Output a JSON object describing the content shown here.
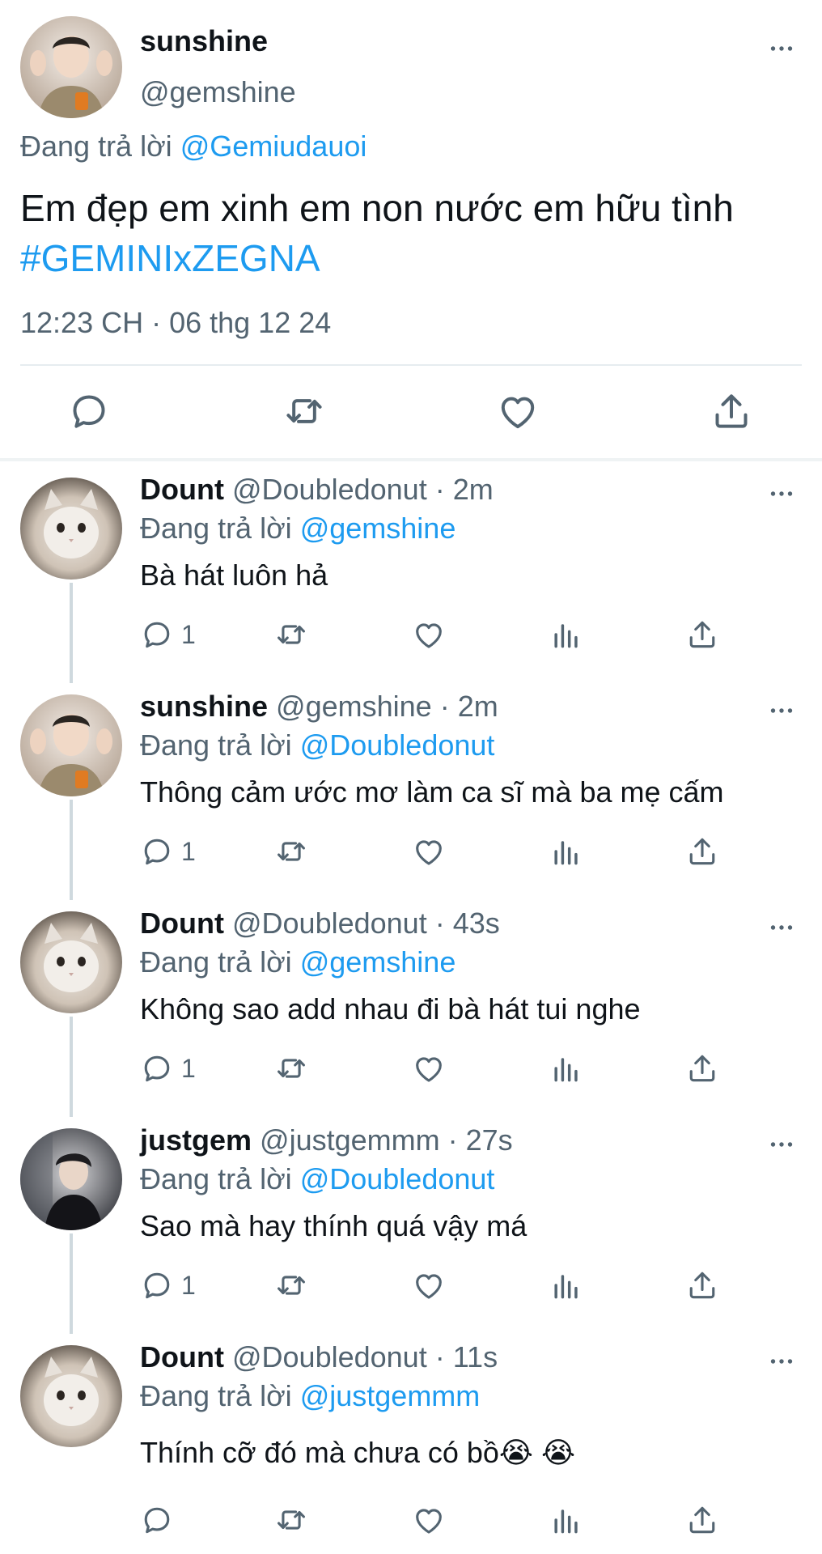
{
  "main_tweet": {
    "name": "sunshine",
    "handle": "@gemshine",
    "reply_prefix": "Đang trả lời",
    "reply_to": "@Gemiudauoi",
    "text": "Em đẹp em xinh em non nước em hữu tình",
    "hashtag": "#GEMINIxZEGNA",
    "timestamp": "12:23 CH · 06 thg 12 24"
  },
  "replies": [
    {
      "name": "Dount",
      "handle": "@Doubledonut",
      "time": "· 2m",
      "reply_prefix": "Đang trả lời",
      "reply_to": "@gemshine",
      "text": "Bà hát luôn hả",
      "reply_count": "1"
    },
    {
      "name": "sunshine",
      "handle": "@gemshine",
      "time": "· 2m",
      "reply_prefix": "Đang trả lời",
      "reply_to": "@Doubledonut",
      "text": "Thông cảm ước mơ làm ca sĩ mà ba mẹ cấm",
      "reply_count": "1"
    },
    {
      "name": "Dount",
      "handle": "@Doubledonut",
      "time": "· 43s",
      "reply_prefix": "Đang trả lời",
      "reply_to": "@gemshine",
      "text": "Không sao add nhau đi bà hát tui nghe",
      "reply_count": "1"
    },
    {
      "name": "justgem",
      "handle": "@justgemmm",
      "time": "· 27s",
      "reply_prefix": "Đang trả lời",
      "reply_to": "@Doubledonut",
      "text": "Sao mà hay thính quá vậy má",
      "reply_count": "1"
    },
    {
      "name": "Dount",
      "handle": "@Doubledonut",
      "time": "· 11s",
      "reply_prefix": "Đang trả lời",
      "reply_to": "@justgemmm",
      "text": "Thính cỡ đó mà chưa có bồ😭 😭",
      "reply_count": ""
    }
  ],
  "icons": {
    "reply": "comment-icon",
    "retweet": "retweet-icon",
    "like": "heart-icon",
    "views": "analytics-icon",
    "share": "share-icon",
    "more": "more-icon"
  },
  "colors": {
    "accent": "#1d9bf0",
    "text_primary": "#0f1419",
    "text_secondary": "#536471",
    "thread_line": "#cfd9de"
  }
}
